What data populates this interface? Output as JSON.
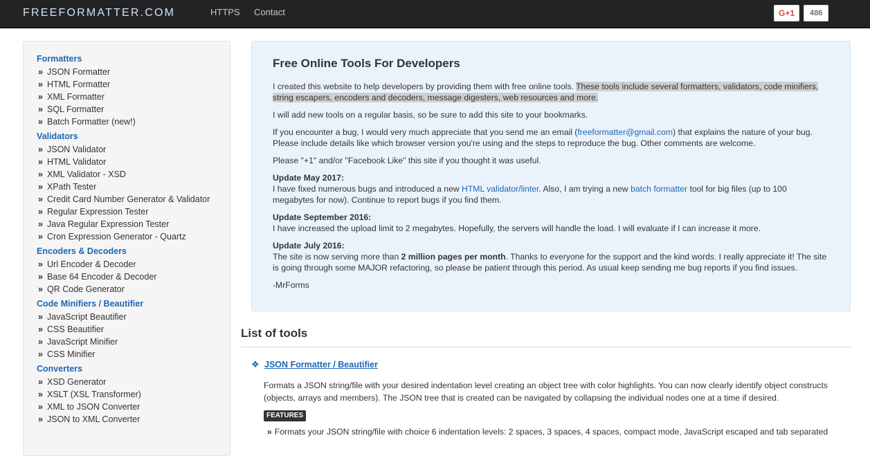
{
  "nav": {
    "brand": "FREEFORMATTER.COM",
    "https": "HTTPS",
    "contact": "Contact",
    "gplus_label": "G+1",
    "gplus_count": "486"
  },
  "sidebar": {
    "sections": [
      {
        "title": "Formatters",
        "items": [
          "JSON Formatter",
          "HTML Formatter",
          "XML Formatter",
          "SQL Formatter",
          "Batch Formatter (new!)"
        ]
      },
      {
        "title": "Validators",
        "items": [
          "JSON Validator",
          "HTML Validator",
          "XML Validator - XSD",
          "XPath Tester",
          "Credit Card Number Generator & Validator",
          "Regular Expression Tester",
          "Java Regular Expression Tester",
          "Cron Expression Generator - Quartz"
        ]
      },
      {
        "title": "Encoders & Decoders",
        "items": [
          "Url Encoder & Decoder",
          "Base 64 Encoder & Decoder",
          "QR Code Generator"
        ]
      },
      {
        "title": "Code Minifiers / Beautifier",
        "items": [
          "JavaScript Beautifier",
          "CSS Beautifier",
          "JavaScript Minifier",
          "CSS Minifier"
        ]
      },
      {
        "title": "Converters",
        "items": [
          "XSD Generator",
          "XSLT (XSL Transformer)",
          "XML to JSON Converter",
          "JSON to XML Converter"
        ]
      }
    ]
  },
  "intro": {
    "title": "Free Online Tools For Developers",
    "p1_a": "I created this website to help developers by providing them with free online tools. ",
    "p1_b": "These tools include several formatters, validators, code minifiers, string escapers, encoders and decoders, message digesters, web resources and more.",
    "p2": "I will add new tools on a regular basis, so be sure to add this site to your bookmarks.",
    "p3_a": "If you encounter a bug, I would very much appreciate that you send me an email (",
    "p3_email": "freeformatter@gmail.com",
    "p3_b": ") that explains the nature of your bug. Please include details like which browser version you're using and the steps to reproduce the bug. Other comments are welcome.",
    "p4": "Please \"+1\" and/or \"Facebook Like\" this site if you thought it was useful.",
    "u1_title": "Update May 2017:",
    "u1_a": "I have fixed numerous bugs and introduced a new ",
    "u1_link1": "HTML validator/linter",
    "u1_b": ". Also, I am trying a new ",
    "u1_link2": "batch formatter",
    "u1_c": " tool for big files (up to 100 megabytes for now). Continue to report bugs if you find them.",
    "u2_title": "Update September 2016:",
    "u2_text": "I have increased the upload limit to 2 megabytes. Hopefully, the servers will handle the load. I will evaluate if I can increase it more.",
    "u3_title": "Update July 2016:",
    "u3_a": "The site is now serving more than ",
    "u3_bold": "2 million pages per month",
    "u3_b": ". Thanks to everyone for the support and the kind words. I really appreciate it! The site is going through some MAJOR refactoring, so please be patient through this period. As usual keep sending me bug reports if you find issues.",
    "signature": "-MrForms"
  },
  "tools": {
    "title": "List of tools",
    "first_tool": "JSON Formatter / Beautifier",
    "first_desc": "Formats a JSON string/file with your desired indentation level creating an object tree with color highlights. You can now clearly identify object constructs (objects, arrays and members). The JSON tree that is created can be navigated by collapsing the individual nodes one at a time if desired.",
    "features_label": "FEATURES",
    "feature_1": "Formats your JSON string/file with choice 6 indentation levels: 2 spaces, 3 spaces, 4 spaces, compact mode, JavaScript escaped and tab separated"
  }
}
